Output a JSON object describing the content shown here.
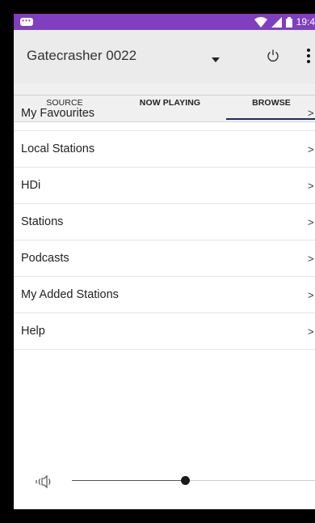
{
  "status_bar": {
    "time": "19:4",
    "icons": [
      "notification-icon",
      "wifi-icon",
      "signal-icon",
      "battery-icon"
    ],
    "color": "#7f3fbf"
  },
  "device": {
    "name": "Gatecrasher 0022"
  },
  "tabs": [
    {
      "label": "SOURCE",
      "active": false
    },
    {
      "label": "NOW PLAYING",
      "active": false
    },
    {
      "label": "BROWSE",
      "active": true
    }
  ],
  "browse": {
    "items": [
      {
        "label": "My Favourites"
      },
      {
        "label": "Local Stations"
      },
      {
        "label": "HDi"
      },
      {
        "label": "Stations"
      },
      {
        "label": "Podcasts"
      },
      {
        "label": "My Added Stations"
      },
      {
        "label": "Help"
      }
    ],
    "chevron": ">"
  },
  "volume": {
    "level": 0.55
  },
  "colors": {
    "accent_underline": "#1f2a6a",
    "header_bg": "#ebebeb"
  }
}
